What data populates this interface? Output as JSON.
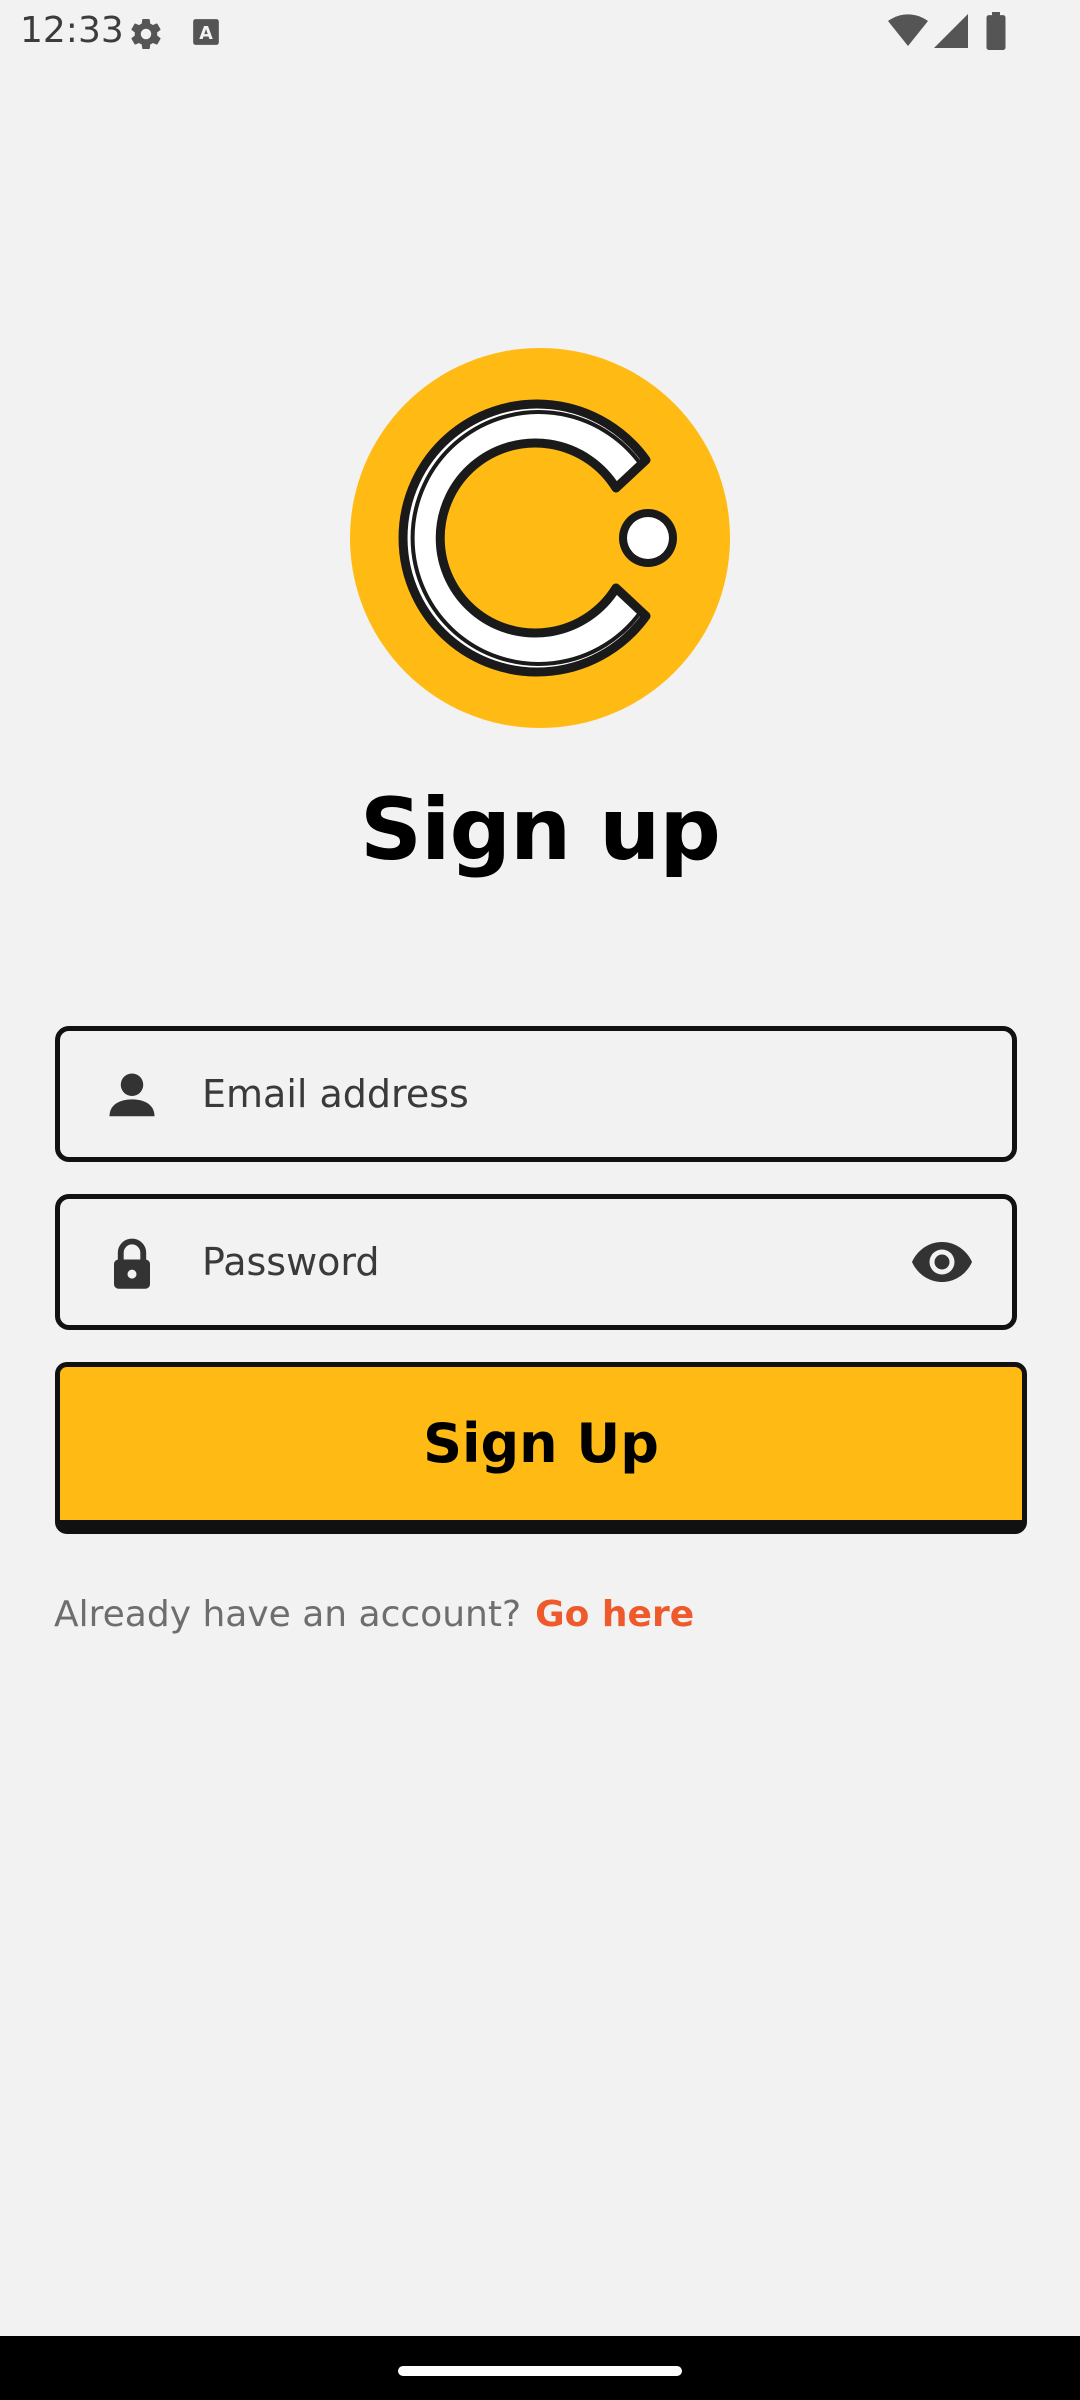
{
  "status_bar": {
    "time": "12:33",
    "icons": [
      "gear-icon",
      "keyboard-a-icon",
      "wifi-icon",
      "signal-icon",
      "battery-icon"
    ]
  },
  "logo": {
    "icon": "c-logo-icon",
    "colors": {
      "circle": "#ffba14",
      "ring": "#ffffff",
      "outline": "#1a1a1a"
    }
  },
  "title": "Sign up",
  "email_field": {
    "icon": "person-icon",
    "placeholder": "Email address",
    "value": ""
  },
  "password_field": {
    "icon": "lock-icon",
    "placeholder": "Password",
    "value": "",
    "toggle_icon": "eye-icon"
  },
  "signup_button": {
    "label": "Sign Up",
    "color": "#ffba14"
  },
  "footer": {
    "prompt": "Already have an account?",
    "link": "Go here",
    "link_color": "#ee5a2c"
  }
}
